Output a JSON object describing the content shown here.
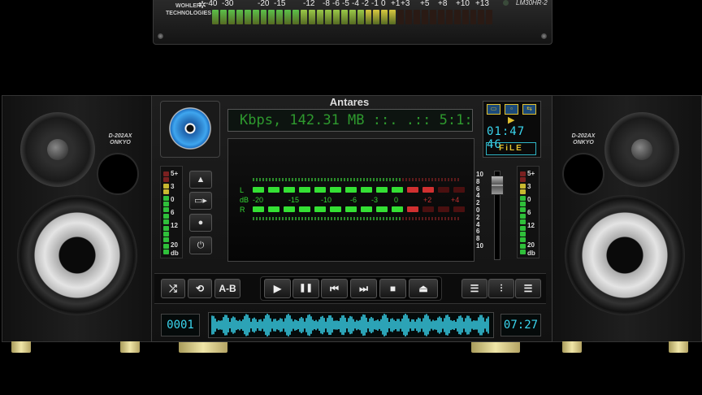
{
  "meter": {
    "brand_line1": "WOHLER",
    "brand_line2": "TECHNOLOGIES",
    "model": "LM30HR-2",
    "scale": [
      "-40",
      "-30",
      "-20",
      "-15",
      "-12",
      "-8",
      "-6",
      "-5",
      "-4",
      "-2",
      "-1",
      "0",
      "+1",
      "+3",
      "+5",
      "+8",
      "+10",
      "+13"
    ],
    "lit_segments": 23,
    "total_segments": 35
  },
  "player": {
    "title": "Antares",
    "lcd_text": "Kbps, 142.31 MB ::.  .:: 5:1:",
    "vu": {
      "channel_l": "L",
      "channel_r": "R",
      "db_prefix": "dB",
      "scale": [
        "-20",
        "-15",
        "-10",
        "-6",
        "-3",
        "0",
        "+2",
        "+4"
      ],
      "left_level_segments": 12,
      "right_level_segments": 11
    },
    "side_meter_labels": [
      "5+",
      "3",
      "0",
      "6",
      "12",
      "20",
      "db"
    ],
    "pitch_labels": [
      "10",
      "8",
      "6",
      "4",
      "2",
      "0",
      "2",
      "4",
      "6",
      "8",
      "10"
    ],
    "mode_panel": {
      "time": "01:47 46",
      "file_label": "FiLE"
    },
    "left_controls": [
      "eject-small",
      "play-record",
      "record",
      "power"
    ],
    "transport": {
      "shuffle": "⤮",
      "repeat": "⟲",
      "ab": "A-B",
      "play": "▶",
      "pause": "❚❚",
      "prev": "⏮",
      "next": "⏭",
      "stop": "■",
      "eject": "⏏",
      "playlist": "☰",
      "equalizer": "⫶",
      "menu": "☰"
    },
    "track_number": "0001",
    "remaining_time": "07:27"
  },
  "speakers": {
    "left": {
      "model": "D-202AX",
      "brand": "ONKYO"
    },
    "right": {
      "model": "D-202AX",
      "brand": "ONKYO"
    }
  },
  "colors": {
    "led_green": "#34d634",
    "led_yellow": "#d8c830",
    "led_red": "#c03030",
    "lcd_cyan": "#3ad6ef",
    "accent_blue": "#3fa6ef"
  }
}
